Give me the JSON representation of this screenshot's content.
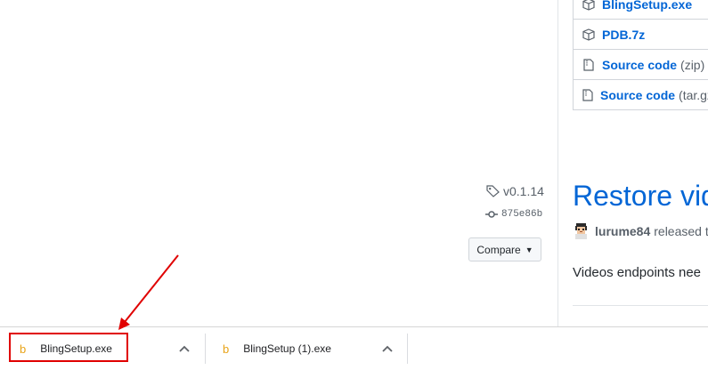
{
  "assets": [
    {
      "name": "BlingSetup.exe",
      "suffix": "",
      "icon": "package-icon"
    },
    {
      "name": "PDB.7z",
      "suffix": "",
      "icon": "package-icon"
    },
    {
      "name": "Source code",
      "suffix": "(zip)",
      "icon": "file-zip-icon"
    },
    {
      "name": "Source code",
      "suffix": "(tar.gz)",
      "icon": "file-zip-icon"
    }
  ],
  "sidebar": {
    "tag": "v0.1.14",
    "commit": "875e86b",
    "compare_label": "Compare"
  },
  "release": {
    "title": "Restore vid",
    "author": "lurume84",
    "released_text": "released th",
    "body": "Videos endpoints nee"
  },
  "downloads": {
    "items": [
      {
        "filename": "BlingSetup.exe",
        "icon": "file-icon"
      },
      {
        "filename": "BlingSetup (1).exe",
        "icon": "file-icon"
      }
    ]
  },
  "colors": {
    "link": "#0366d6",
    "annotation": "#e00000",
    "file_icon": "#e8a317"
  }
}
